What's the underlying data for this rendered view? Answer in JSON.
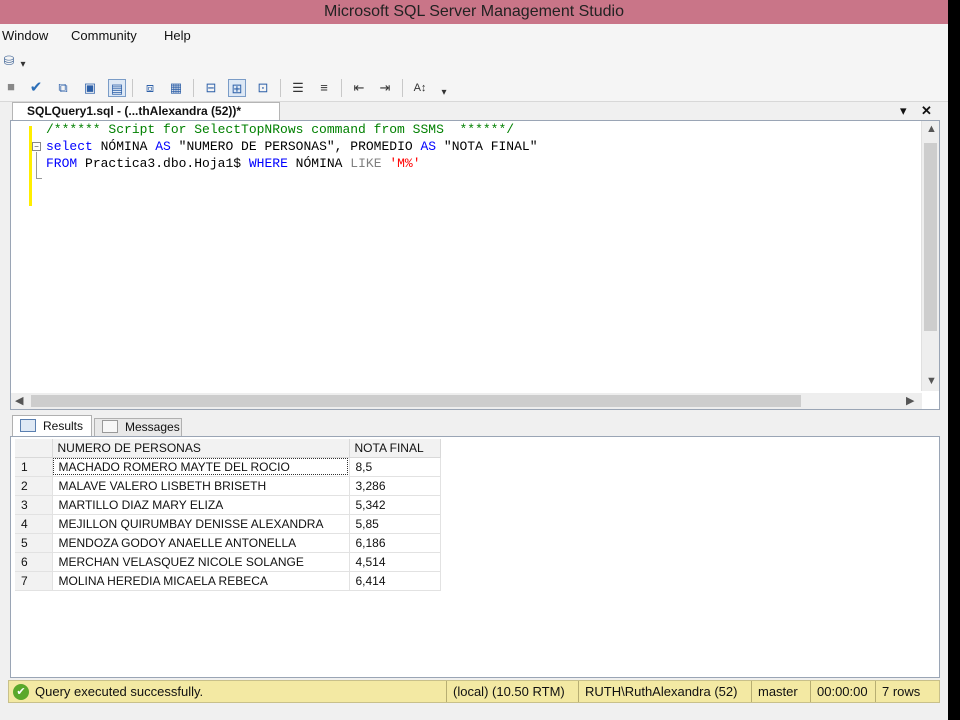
{
  "window": {
    "title": "Microsoft SQL Server Management Studio"
  },
  "menu": {
    "items": [
      "Window",
      "Community",
      "Help"
    ]
  },
  "document_tab": {
    "label": "SQLQuery1.sql - (...thAlexandra (52))*",
    "dropdown_glyph": "▾",
    "close_glyph": "✕"
  },
  "editor": {
    "line1_comment": "/****** Script for SelectTopNRows command from SSMS  ******/",
    "line2": {
      "kw1": "select",
      "t1": " NÓMINA ",
      "kw2": "AS",
      "t2": " \"NUMERO DE PERSONAS\", PROMEDIO ",
      "kw3": "AS",
      "t3": " \"NOTA FINAL\""
    },
    "line3": {
      "kw1": "FROM",
      "t1": " Practica3.dbo.Hoja1$ ",
      "kw2": "WHERE",
      "t2": " NÓMINA ",
      "op": "LIKE",
      "t3": " ",
      "str": "'M%'"
    }
  },
  "results_tabs": {
    "results": "Results",
    "messages": "Messages"
  },
  "grid": {
    "columns": [
      "NUMERO DE PERSONAS",
      "NOTA FINAL"
    ],
    "rows": [
      {
        "num": "1",
        "name": "MACHADO ROMERO MAYTE DEL ROCIO",
        "nota": "8,5"
      },
      {
        "num": "2",
        "name": "MALAVE VALERO LISBETH BRISETH",
        "nota": "3,286"
      },
      {
        "num": "3",
        "name": "MARTILLO DIAZ MARY ELIZA",
        "nota": "5,342"
      },
      {
        "num": "4",
        "name": "MEJILLON QUIRUMBAY DENISSE ALEXANDRA",
        "nota": "5,85"
      },
      {
        "num": "5",
        "name": "MENDOZA GODOY ANAELLE ANTONELLA",
        "nota": "6,186"
      },
      {
        "num": "6",
        "name": "MERCHAN VELASQUEZ NICOLE SOLANGE",
        "nota": "4,514"
      },
      {
        "num": "7",
        "name": "MOLINA HEREDIA MICAELA REBECA",
        "nota": "6,414"
      }
    ]
  },
  "status": {
    "message": "Query executed successfully.",
    "server": "(local) (10.50 RTM)",
    "user": "RUTH\\RuthAlexandra (52)",
    "database": "master",
    "elapsed": "00:00:00",
    "rows": "7 rows"
  },
  "colors": {
    "title_bar": "#c97588",
    "status_bar": "#f3e9a3",
    "keyword": "#0000ff",
    "comment": "#008000",
    "string": "#ff0000"
  }
}
